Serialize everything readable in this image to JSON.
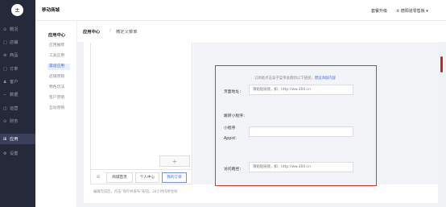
{
  "sidebar": {
    "logo": "±",
    "items": [
      {
        "icon": "⊙",
        "label": "概况"
      },
      {
        "icon": "□",
        "label": "店铺"
      },
      {
        "icon": "⊕",
        "label": "商品"
      },
      {
        "icon": "□",
        "label": "订单"
      },
      {
        "icon": "♟",
        "label": "客户"
      },
      {
        "icon": "∽",
        "label": "数据"
      },
      {
        "icon": "◫",
        "label": "运营"
      },
      {
        "icon": "⊙",
        "label": "财务"
      },
      {
        "icon": "⊞",
        "label": "应用"
      },
      {
        "icon": "⚙",
        "label": "设置"
      }
    ],
    "active_index": 8
  },
  "topbar": {
    "shop_name": "移动商城",
    "upgrade": "套餐升级",
    "user": "± 德阳道零售板 ▾"
  },
  "subnav": {
    "title": "应用中心",
    "items": [
      "应用推荐",
      "工具应用",
      "渠道应用",
      "店铺营销",
      "物色玩法",
      "客户营销",
      "互动营销"
    ],
    "active_index": 2
  },
  "breadcrumb": {
    "root": "应用中心",
    "sep": "/",
    "current": "微定义菜单"
  },
  "editor": {
    "add_symbol": "+",
    "tab_icon": "⊞",
    "tabs": [
      "商城首页",
      "个人中心",
      "我的订单"
    ],
    "active_tab": 2,
    "note": "编辑完成后，点击“保存并发布”按钮，24小时内将生效"
  },
  "form": {
    "hint": "订阅者点击该子菜单会跳到以下链接，",
    "hint_link": "建议添加内容",
    "page_label": "页面地址：",
    "page_placeholder": "请粘贴链接，如：http://ww.300.cn",
    "mini_label": "跳转小程序：",
    "mini_sub_label": "小程序",
    "appid_label": "Appid：",
    "appid_value": "",
    "path_label": "访问路径：",
    "path_placeholder": "请粘贴链接，如：http://ww.300.cn"
  },
  "colors": {
    "sidebar_bg": "#26293a",
    "accent": "#3b6bf1",
    "highlight_border": "#e0352b"
  }
}
